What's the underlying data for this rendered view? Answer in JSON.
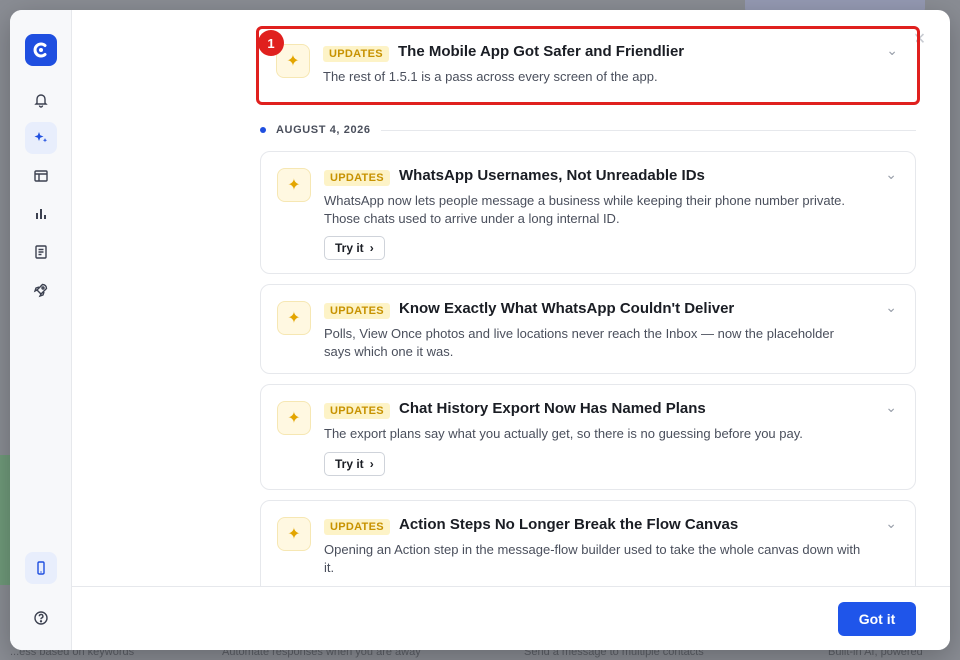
{
  "background": {
    "bottom_texts": [
      "...ess based on keywords",
      "Automate responses when you are away",
      "Send a message to multiple contacts",
      "Built-in AI, powered"
    ]
  },
  "rail": {
    "logo_icon": "brand-logo-icon",
    "items": [
      {
        "icon": "bell-icon"
      },
      {
        "icon": "sparkles-icon",
        "active": true
      },
      {
        "icon": "calendar-grid-icon"
      },
      {
        "icon": "bar-chart-icon"
      },
      {
        "icon": "document-icon"
      },
      {
        "icon": "rocket-icon"
      },
      {
        "icon": "mobile-icon",
        "active": true
      },
      {
        "icon": "help-circle-icon"
      }
    ]
  },
  "changelog": {
    "highlight_number": "1",
    "top_entry": {
      "tag": "UPDATES",
      "title": "The Mobile App Got Safer and Friendlier",
      "description": "The rest of 1.5.1 is a pass across every screen of the app."
    },
    "date_label": "AUGUST 4, 2026",
    "entries": [
      {
        "tag": "UPDATES",
        "title": "WhatsApp Usernames, Not Unreadable IDs",
        "description": "WhatsApp now lets people message a business while keeping their phone number private. Those chats used to arrive under a long internal ID.",
        "action": "Try it"
      },
      {
        "tag": "UPDATES",
        "title": "Know Exactly What WhatsApp Couldn't Deliver",
        "description": "Polls, View Once photos and live locations never reach the Inbox — now the placeholder says which one it was."
      },
      {
        "tag": "UPDATES",
        "title": "Chat History Export Now Has Named Plans",
        "description": "The export plans say what you actually get, so there is no guessing before you pay.",
        "action": "Try it"
      },
      {
        "tag": "UPDATES",
        "title": "Action Steps No Longer Break the Flow Canvas",
        "description": "Opening an Action step in the message-flow builder used to take the whole canvas down with it."
      }
    ]
  },
  "footer": {
    "got_it_label": "Got it"
  },
  "colors": {
    "accent": "#1f55ea",
    "highlight": "#e0201e",
    "tag_bg": "#fdf3c7",
    "tag_text": "#c79200"
  }
}
